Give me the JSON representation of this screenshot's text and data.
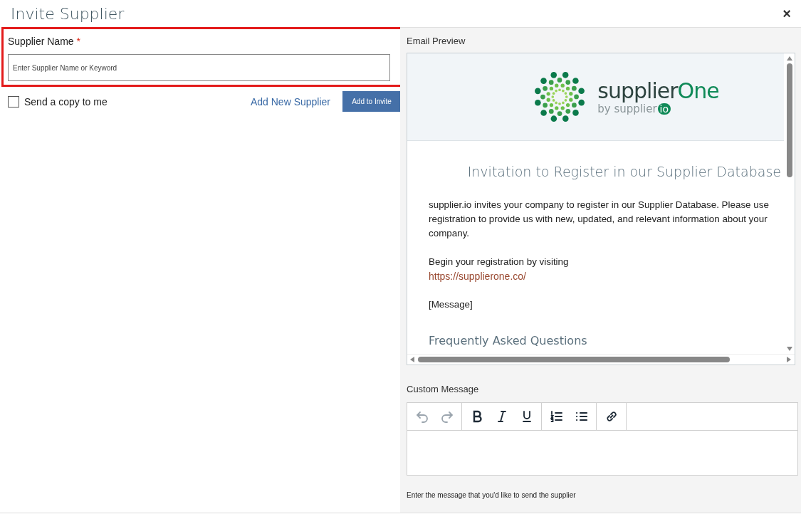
{
  "window": {
    "title": "Invite Supplier",
    "close": "×"
  },
  "supplier_name": {
    "label": "Supplier Name",
    "required_mark": "*",
    "placeholder": "Enter Supplier Name or Keyword",
    "highlighted": true
  },
  "send_copy": {
    "label": "Send a copy to me",
    "checked": false
  },
  "add_new_link": "Add New Supplier",
  "add_button": "Add to Invite",
  "email_preview": {
    "label": "Email Preview",
    "logo": {
      "name": "supplier",
      "name_accent": "One",
      "byline": "by supplier",
      "byline_badge": "io"
    },
    "heading": "Invitation to Register in our Supplier Database",
    "paragraphs": [
      {
        "kind": "text",
        "text": "supplier.io invites your company to register in our Supplier Database. Please use registration to provide us with new, updated, and relevant information about your company."
      },
      {
        "kind": "text",
        "text": "Begin your registration by visiting"
      },
      {
        "kind": "link",
        "text": "https://supplierone.co/"
      },
      {
        "kind": "text",
        "text": "[Message]"
      }
    ],
    "subheading": "Frequently Asked Questions"
  },
  "custom_message": {
    "label": "Custom Message",
    "toolbar": [
      [
        {
          "kind": "undo",
          "disabled": true
        },
        {
          "kind": "redo",
          "disabled": true
        }
      ],
      [
        {
          "kind": "bold",
          "disabled": false
        },
        {
          "kind": "italic",
          "disabled": false
        },
        {
          "kind": "underline",
          "disabled": false
        }
      ],
      [
        {
          "kind": "ordered-list",
          "disabled": false
        },
        {
          "kind": "bullet-list",
          "disabled": false
        }
      ],
      [
        {
          "kind": "link",
          "disabled": false
        }
      ]
    ],
    "help": "Enter the message that you'd like to send the supplier"
  }
}
